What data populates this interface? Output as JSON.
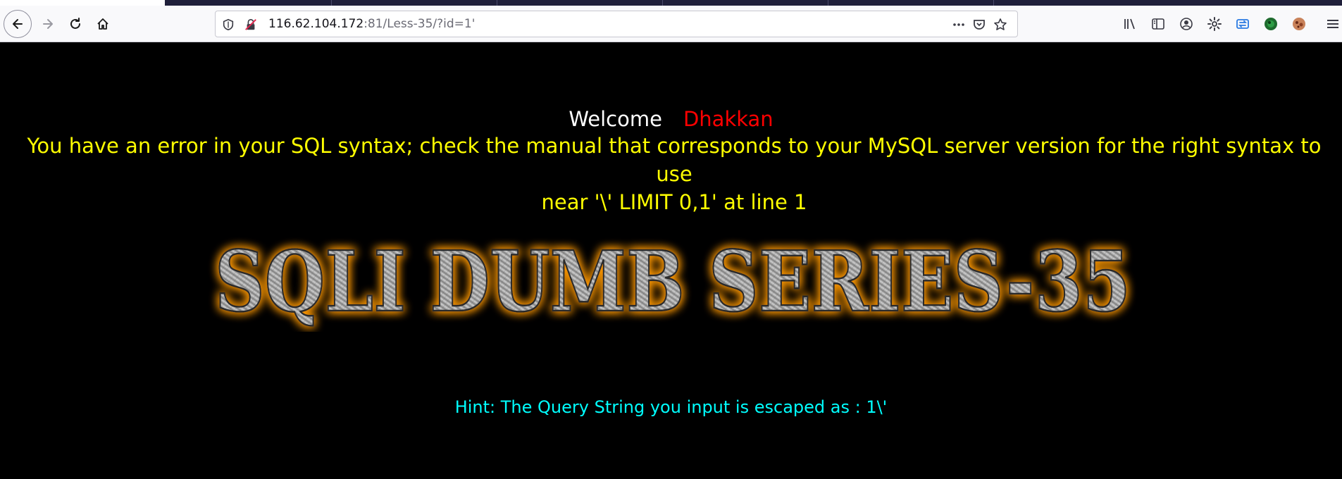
{
  "browser": {
    "url_host": "116.62.104.172",
    "url_rest": ":81/Less-35/?id=1'",
    "icons": [
      "back-arrow-icon",
      "forward-arrow-icon",
      "reload-icon",
      "home-icon",
      "shield-icon",
      "insecure-lock-icon",
      "more-icon",
      "pocket-icon",
      "bookmark-star-icon",
      "library-icon",
      "sidebar-icon",
      "account-icon",
      "settings-icon",
      "sync-icon",
      "extension-icon",
      "avatar-icon",
      "menu-icon"
    ]
  },
  "page": {
    "welcome_label": "Welcome",
    "welcome_name": "Dhakkan",
    "error_line1": "You have an error in your SQL syntax; check the manual that corresponds to your MySQL server version for the right syntax to use",
    "error_line2": "near '\\' LIMIT 0,1' at line 1",
    "banner_text": "SQLI DUMB SERIES-35",
    "hint": "Hint: The Query String you input is escaped as : 1\\'"
  },
  "colors": {
    "background": "#000000",
    "welcome": "#ffffff",
    "name": "#ff0000",
    "error": "#ffff00",
    "hint": "#00ffff",
    "banner_glow": "#ff9900"
  }
}
